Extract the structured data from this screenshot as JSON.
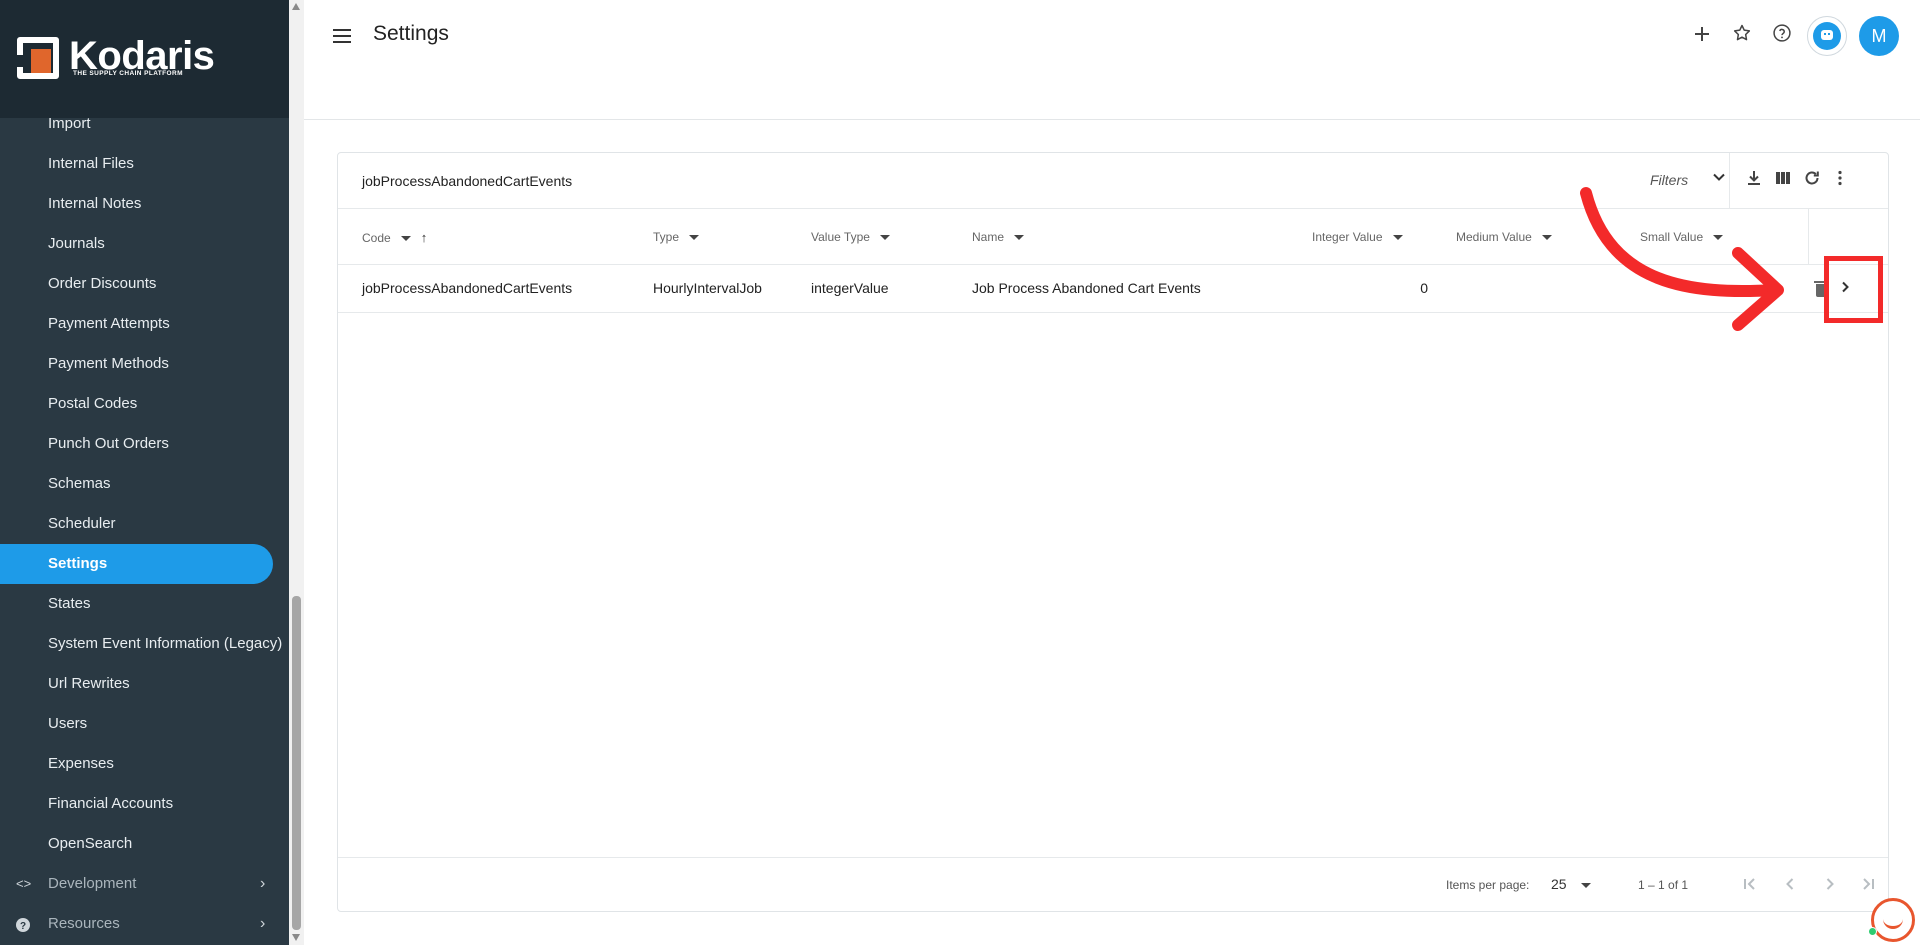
{
  "sidebar": {
    "brand": "Kodaris",
    "tagline": "THE SUPPLY CHAIN PLATFORM",
    "items": [
      {
        "label": "Import"
      },
      {
        "label": "Internal Files"
      },
      {
        "label": "Internal Notes"
      },
      {
        "label": "Journals"
      },
      {
        "label": "Order Discounts"
      },
      {
        "label": "Payment Attempts"
      },
      {
        "label": "Payment Methods"
      },
      {
        "label": "Postal Codes"
      },
      {
        "label": "Punch Out Orders"
      },
      {
        "label": "Schemas"
      },
      {
        "label": "Scheduler"
      },
      {
        "label": "Settings",
        "active": true
      },
      {
        "label": "States"
      },
      {
        "label": "System Event Information (Legacy)"
      },
      {
        "label": "Url Rewrites"
      },
      {
        "label": "Users"
      },
      {
        "label": "Expenses"
      },
      {
        "label": "Financial Accounts"
      },
      {
        "label": "OpenSearch"
      }
    ],
    "groups": [
      {
        "label": "Development",
        "icon": "code-icon"
      },
      {
        "label": "Resources",
        "icon": "help-circle-icon"
      }
    ]
  },
  "header": {
    "title": "Settings",
    "avatar_initial": "M",
    "icons": [
      "add-icon",
      "star-icon",
      "help-icon",
      "assistant-bot-icon"
    ]
  },
  "table": {
    "title": "jobProcessAbandonedCartEvents",
    "filters_label": "Filters",
    "columns": [
      "Code",
      "Type",
      "Value Type",
      "Name",
      "Integer Value",
      "Medium Value",
      "Small Value"
    ],
    "rows": [
      {
        "code": "jobProcessAbandonedCartEvents",
        "type": "HourlyIntervalJob",
        "value_type": "integerValue",
        "name": "Job Process Abandoned Cart Events",
        "integer_value": "0",
        "medium_value": "",
        "small_value": ""
      }
    ],
    "footer": {
      "items_per_page_label": "Items per page:",
      "items_per_page": "25",
      "range": "1 – 1 of 1"
    }
  },
  "colors": {
    "accent": "#1e9be8",
    "sidebar_bg": "#2a3943",
    "annotation": "#f32a2a",
    "brand_orange": "#e0662c"
  }
}
